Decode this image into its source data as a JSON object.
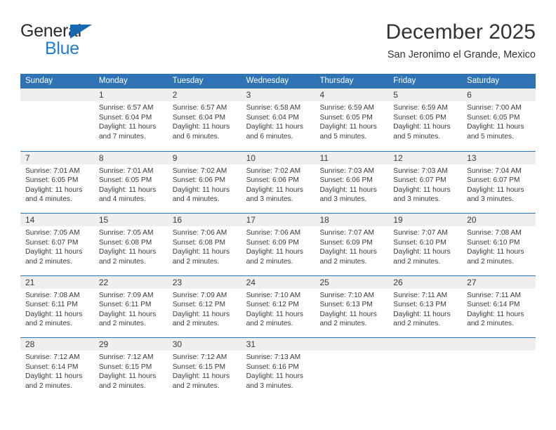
{
  "brand": {
    "word_one": "General",
    "word_two": "Blue",
    "accent_color": "#1668b3",
    "blue_text_color": "#1f7fd0"
  },
  "header": {
    "title": "December 2025",
    "subtitle": "San Jeronimo el Grande, Mexico"
  },
  "calendar": {
    "header_color": "#2e74b5",
    "day_band_color": "#efefef",
    "day_names": [
      "Sunday",
      "Monday",
      "Tuesday",
      "Wednesday",
      "Thursday",
      "Friday",
      "Saturday"
    ],
    "weeks": [
      [
        {
          "day": "",
          "sunrise": "",
          "sunset": "",
          "daylight_line1": "",
          "daylight_line2": ""
        },
        {
          "day": "1",
          "sunrise": "Sunrise: 6:57 AM",
          "sunset": "Sunset: 6:04 PM",
          "daylight_line1": "Daylight: 11 hours",
          "daylight_line2": "and 7 minutes."
        },
        {
          "day": "2",
          "sunrise": "Sunrise: 6:57 AM",
          "sunset": "Sunset: 6:04 PM",
          "daylight_line1": "Daylight: 11 hours",
          "daylight_line2": "and 6 minutes."
        },
        {
          "day": "3",
          "sunrise": "Sunrise: 6:58 AM",
          "sunset": "Sunset: 6:04 PM",
          "daylight_line1": "Daylight: 11 hours",
          "daylight_line2": "and 6 minutes."
        },
        {
          "day": "4",
          "sunrise": "Sunrise: 6:59 AM",
          "sunset": "Sunset: 6:05 PM",
          "daylight_line1": "Daylight: 11 hours",
          "daylight_line2": "and 5 minutes."
        },
        {
          "day": "5",
          "sunrise": "Sunrise: 6:59 AM",
          "sunset": "Sunset: 6:05 PM",
          "daylight_line1": "Daylight: 11 hours",
          "daylight_line2": "and 5 minutes."
        },
        {
          "day": "6",
          "sunrise": "Sunrise: 7:00 AM",
          "sunset": "Sunset: 6:05 PM",
          "daylight_line1": "Daylight: 11 hours",
          "daylight_line2": "and 5 minutes."
        }
      ],
      [
        {
          "day": "7",
          "sunrise": "Sunrise: 7:01 AM",
          "sunset": "Sunset: 6:05 PM",
          "daylight_line1": "Daylight: 11 hours",
          "daylight_line2": "and 4 minutes."
        },
        {
          "day": "8",
          "sunrise": "Sunrise: 7:01 AM",
          "sunset": "Sunset: 6:05 PM",
          "daylight_line1": "Daylight: 11 hours",
          "daylight_line2": "and 4 minutes."
        },
        {
          "day": "9",
          "sunrise": "Sunrise: 7:02 AM",
          "sunset": "Sunset: 6:06 PM",
          "daylight_line1": "Daylight: 11 hours",
          "daylight_line2": "and 4 minutes."
        },
        {
          "day": "10",
          "sunrise": "Sunrise: 7:02 AM",
          "sunset": "Sunset: 6:06 PM",
          "daylight_line1": "Daylight: 11 hours",
          "daylight_line2": "and 3 minutes."
        },
        {
          "day": "11",
          "sunrise": "Sunrise: 7:03 AM",
          "sunset": "Sunset: 6:06 PM",
          "daylight_line1": "Daylight: 11 hours",
          "daylight_line2": "and 3 minutes."
        },
        {
          "day": "12",
          "sunrise": "Sunrise: 7:03 AM",
          "sunset": "Sunset: 6:07 PM",
          "daylight_line1": "Daylight: 11 hours",
          "daylight_line2": "and 3 minutes."
        },
        {
          "day": "13",
          "sunrise": "Sunrise: 7:04 AM",
          "sunset": "Sunset: 6:07 PM",
          "daylight_line1": "Daylight: 11 hours",
          "daylight_line2": "and 3 minutes."
        }
      ],
      [
        {
          "day": "14",
          "sunrise": "Sunrise: 7:05 AM",
          "sunset": "Sunset: 6:07 PM",
          "daylight_line1": "Daylight: 11 hours",
          "daylight_line2": "and 2 minutes."
        },
        {
          "day": "15",
          "sunrise": "Sunrise: 7:05 AM",
          "sunset": "Sunset: 6:08 PM",
          "daylight_line1": "Daylight: 11 hours",
          "daylight_line2": "and 2 minutes."
        },
        {
          "day": "16",
          "sunrise": "Sunrise: 7:06 AM",
          "sunset": "Sunset: 6:08 PM",
          "daylight_line1": "Daylight: 11 hours",
          "daylight_line2": "and 2 minutes."
        },
        {
          "day": "17",
          "sunrise": "Sunrise: 7:06 AM",
          "sunset": "Sunset: 6:09 PM",
          "daylight_line1": "Daylight: 11 hours",
          "daylight_line2": "and 2 minutes."
        },
        {
          "day": "18",
          "sunrise": "Sunrise: 7:07 AM",
          "sunset": "Sunset: 6:09 PM",
          "daylight_line1": "Daylight: 11 hours",
          "daylight_line2": "and 2 minutes."
        },
        {
          "day": "19",
          "sunrise": "Sunrise: 7:07 AM",
          "sunset": "Sunset: 6:10 PM",
          "daylight_line1": "Daylight: 11 hours",
          "daylight_line2": "and 2 minutes."
        },
        {
          "day": "20",
          "sunrise": "Sunrise: 7:08 AM",
          "sunset": "Sunset: 6:10 PM",
          "daylight_line1": "Daylight: 11 hours",
          "daylight_line2": "and 2 minutes."
        }
      ],
      [
        {
          "day": "21",
          "sunrise": "Sunrise: 7:08 AM",
          "sunset": "Sunset: 6:11 PM",
          "daylight_line1": "Daylight: 11 hours",
          "daylight_line2": "and 2 minutes."
        },
        {
          "day": "22",
          "sunrise": "Sunrise: 7:09 AM",
          "sunset": "Sunset: 6:11 PM",
          "daylight_line1": "Daylight: 11 hours",
          "daylight_line2": "and 2 minutes."
        },
        {
          "day": "23",
          "sunrise": "Sunrise: 7:09 AM",
          "sunset": "Sunset: 6:12 PM",
          "daylight_line1": "Daylight: 11 hours",
          "daylight_line2": "and 2 minutes."
        },
        {
          "day": "24",
          "sunrise": "Sunrise: 7:10 AM",
          "sunset": "Sunset: 6:12 PM",
          "daylight_line1": "Daylight: 11 hours",
          "daylight_line2": "and 2 minutes."
        },
        {
          "day": "25",
          "sunrise": "Sunrise: 7:10 AM",
          "sunset": "Sunset: 6:13 PM",
          "daylight_line1": "Daylight: 11 hours",
          "daylight_line2": "and 2 minutes."
        },
        {
          "day": "26",
          "sunrise": "Sunrise: 7:11 AM",
          "sunset": "Sunset: 6:13 PM",
          "daylight_line1": "Daylight: 11 hours",
          "daylight_line2": "and 2 minutes."
        },
        {
          "day": "27",
          "sunrise": "Sunrise: 7:11 AM",
          "sunset": "Sunset: 6:14 PM",
          "daylight_line1": "Daylight: 11 hours",
          "daylight_line2": "and 2 minutes."
        }
      ],
      [
        {
          "day": "28",
          "sunrise": "Sunrise: 7:12 AM",
          "sunset": "Sunset: 6:14 PM",
          "daylight_line1": "Daylight: 11 hours",
          "daylight_line2": "and 2 minutes."
        },
        {
          "day": "29",
          "sunrise": "Sunrise: 7:12 AM",
          "sunset": "Sunset: 6:15 PM",
          "daylight_line1": "Daylight: 11 hours",
          "daylight_line2": "and 2 minutes."
        },
        {
          "day": "30",
          "sunrise": "Sunrise: 7:12 AM",
          "sunset": "Sunset: 6:15 PM",
          "daylight_line1": "Daylight: 11 hours",
          "daylight_line2": "and 2 minutes."
        },
        {
          "day": "31",
          "sunrise": "Sunrise: 7:13 AM",
          "sunset": "Sunset: 6:16 PM",
          "daylight_line1": "Daylight: 11 hours",
          "daylight_line2": "and 3 minutes."
        },
        {
          "day": "",
          "sunrise": "",
          "sunset": "",
          "daylight_line1": "",
          "daylight_line2": ""
        },
        {
          "day": "",
          "sunrise": "",
          "sunset": "",
          "daylight_line1": "",
          "daylight_line2": ""
        },
        {
          "day": "",
          "sunrise": "",
          "sunset": "",
          "daylight_line1": "",
          "daylight_line2": ""
        }
      ]
    ]
  }
}
